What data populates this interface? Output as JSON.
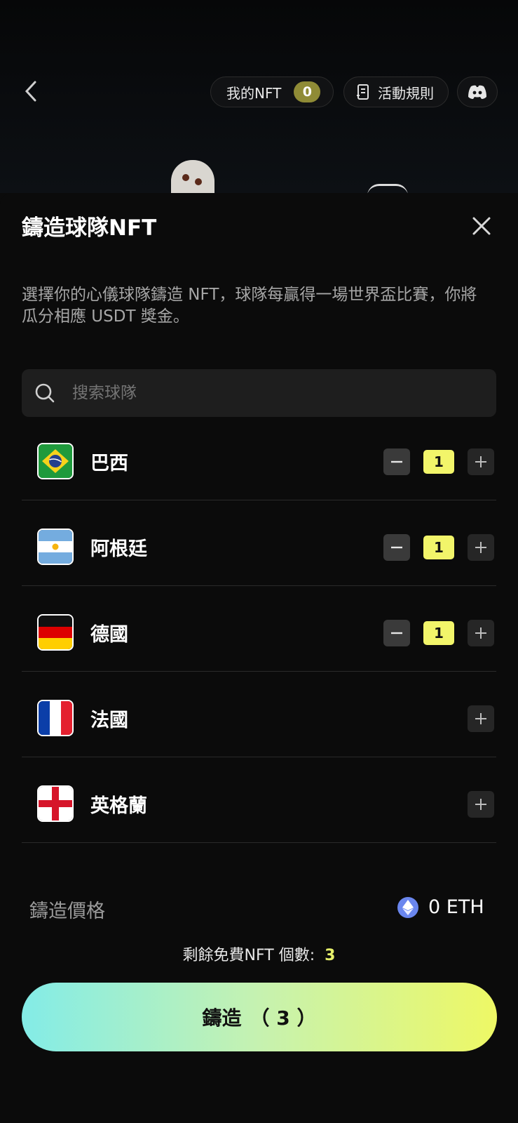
{
  "header": {
    "back_icon": "chevron-left-icon",
    "my_nft_label": "我的NFT",
    "my_nft_count": "0",
    "rules_label": "活動規則",
    "discord_icon": "discord-icon"
  },
  "sheet": {
    "title": "鑄造球隊NFT",
    "description": "選擇你的心儀球隊鑄造 NFT，球隊每贏得一場世界盃比賽，你將瓜分相應 USDT 獎金。",
    "search_placeholder": "搜索球隊",
    "teams": [
      {
        "name": "巴西",
        "quantity": "1",
        "flag": "brazil-flag-icon"
      },
      {
        "name": "阿根廷",
        "quantity": "1",
        "flag": "argentina-flag-icon"
      },
      {
        "name": "德國",
        "quantity": "1",
        "flag": "germany-flag-icon"
      },
      {
        "name": "法國",
        "flag": "france-flag-icon"
      },
      {
        "name": "英格蘭",
        "flag": "england-flag-icon"
      }
    ],
    "price_label": "鑄造價格",
    "price_value": "0 ETH",
    "free_label": "剩餘免費NFT 個數:",
    "free_count": "3",
    "mint_label": "鑄造",
    "mint_count": "（ 3 ）"
  },
  "colors": {
    "accent_yellow": "#f2f56a",
    "mint_gradient_start": "#83ece7",
    "mint_gradient_end": "#eef865",
    "badge_bg": "#8f8b36"
  }
}
